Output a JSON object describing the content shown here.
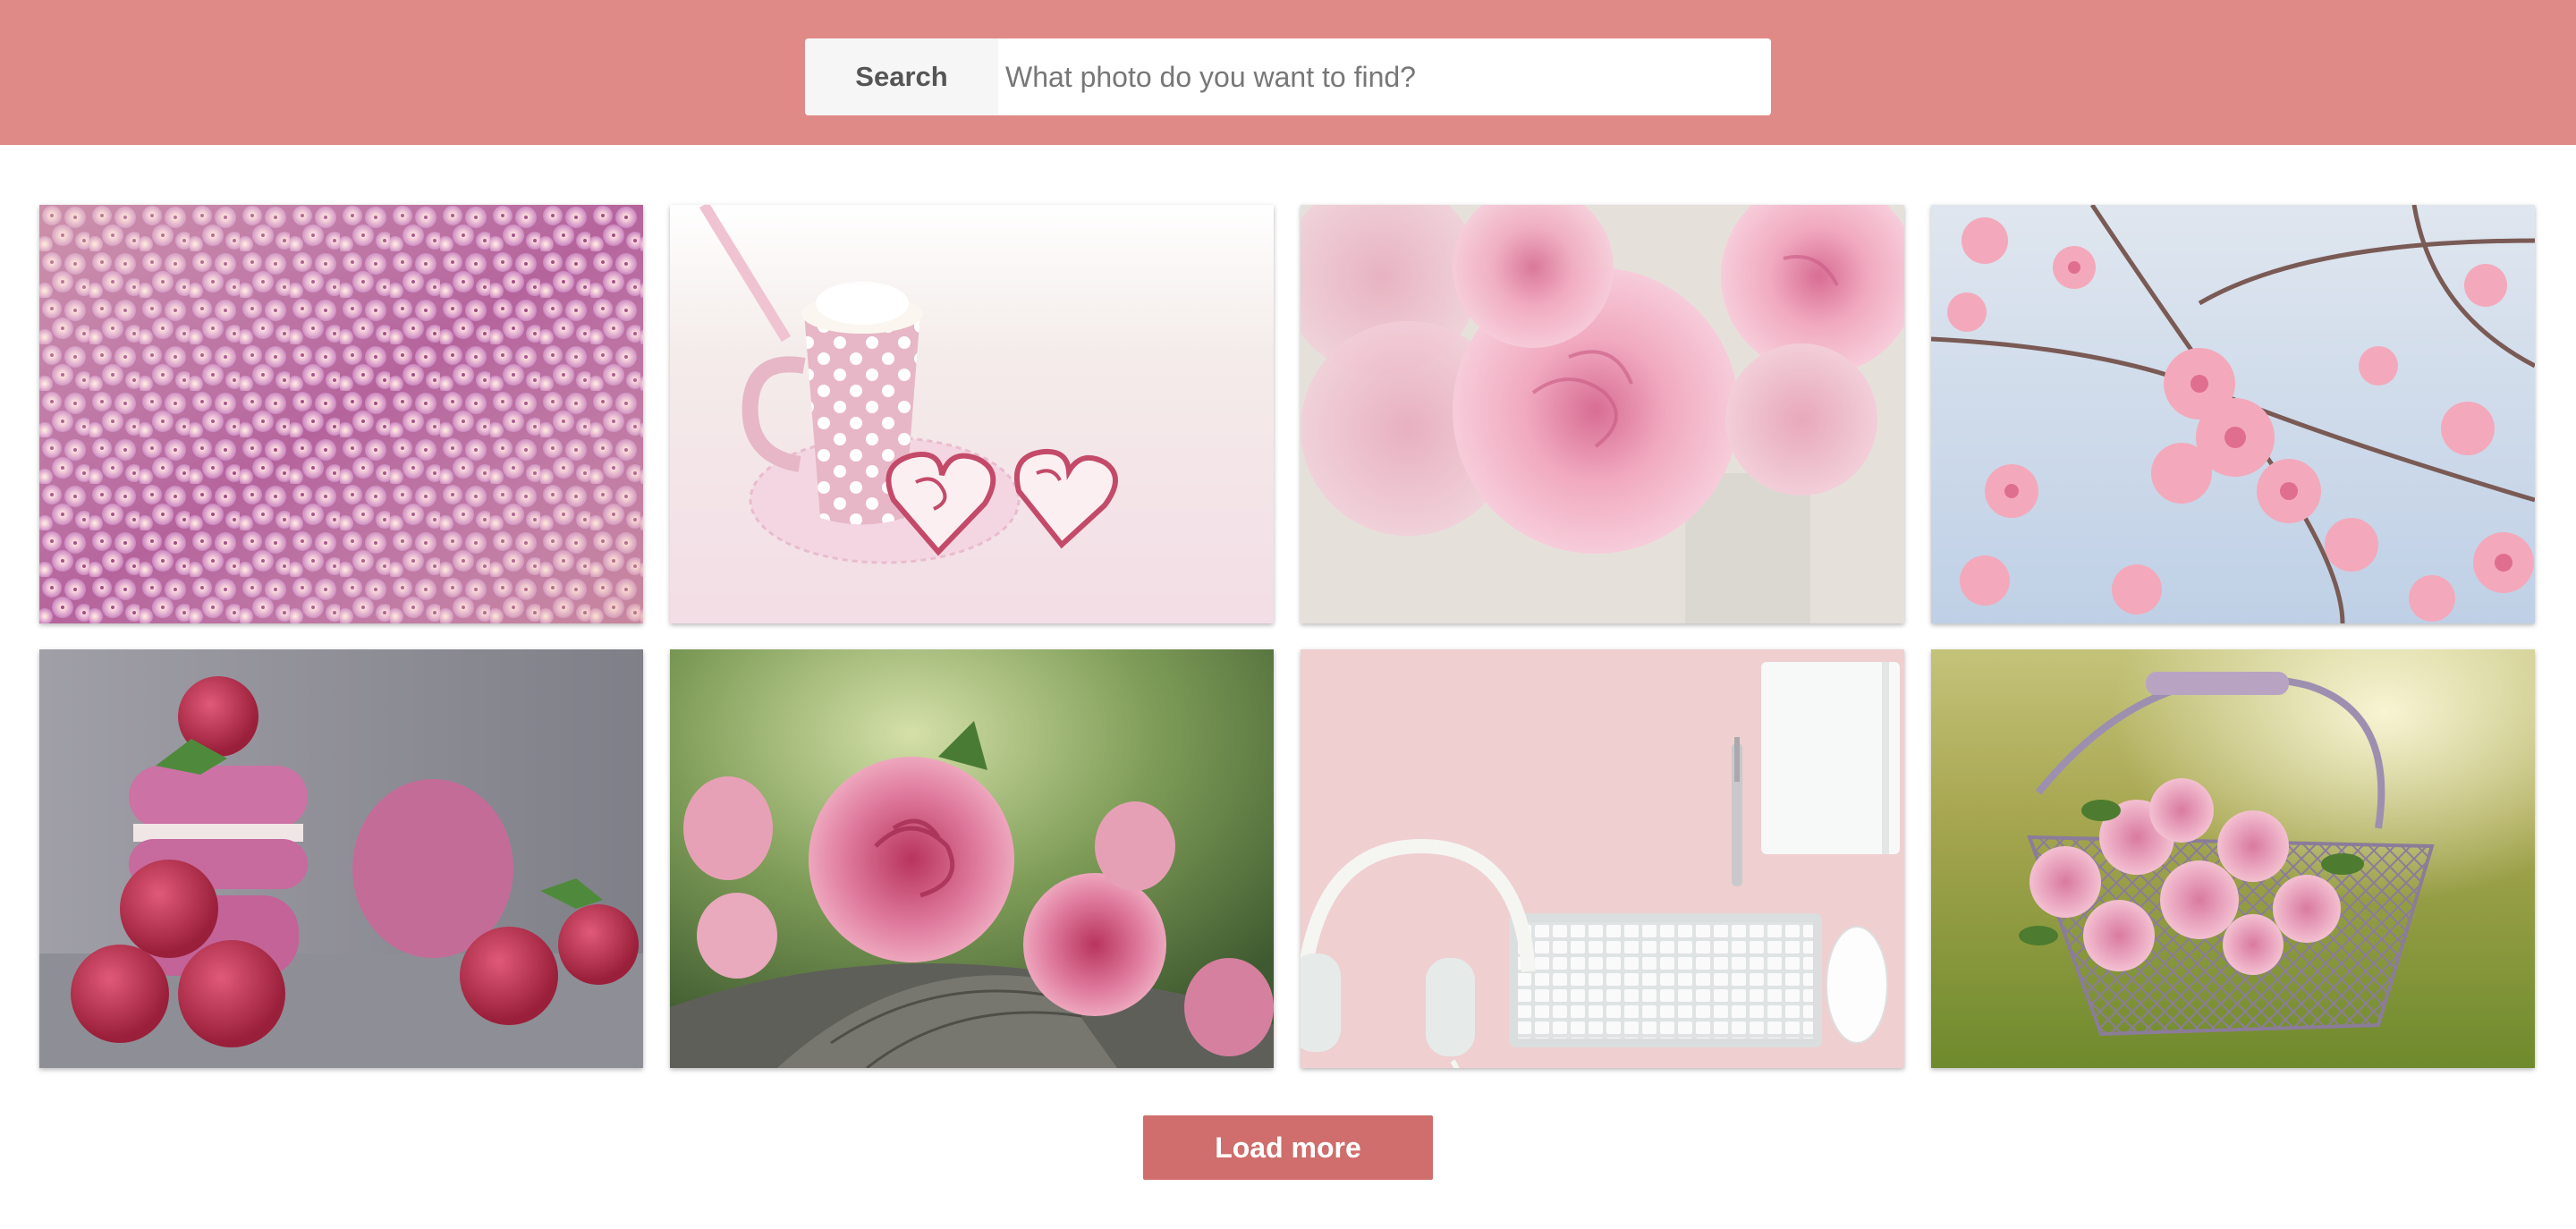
{
  "search": {
    "button_label": "Search",
    "placeholder": "What photo do you want to find?",
    "value": ""
  },
  "photos": [
    {
      "subject": "pink and purple hydrangea blossoms",
      "colors": [
        "#f3c9d6",
        "#c989c4",
        "#f5eac6"
      ]
    },
    {
      "subject": "pink polka-dot cup with whipped cream and heart cookies",
      "colors": [
        "#f7eef2",
        "#e8bccb",
        "#c44a6a"
      ]
    },
    {
      "subject": "pink carnations in a glass vase",
      "colors": [
        "#e8e2dd",
        "#f2b8c9",
        "#e590a9"
      ]
    },
    {
      "subject": "pink cherry blossoms against blue sky",
      "colors": [
        "#c9d8ea",
        "#f2a7b9",
        "#7a5a55"
      ]
    },
    {
      "subject": "pink macarons with raspberries",
      "colors": [
        "#8f8f96",
        "#c9699d",
        "#b02846"
      ]
    },
    {
      "subject": "pink roses on a wooden log",
      "colors": [
        "#8fa867",
        "#d96990",
        "#6a6a64"
      ]
    },
    {
      "subject": "white keyboard, headphones and notebook on pink desk",
      "colors": [
        "#efcfd0",
        "#f4f4f4",
        "#c9c9c9"
      ]
    },
    {
      "subject": "pink roses in a wire basket on grass",
      "colors": [
        "#9fa23e",
        "#f0b8ca",
        "#8b7c9a"
      ]
    }
  ],
  "load_more_label": "Load more",
  "colors": {
    "header": "#e08a87",
    "button": "#cf6e6c",
    "search_button_bg": "#f6f6f6"
  }
}
